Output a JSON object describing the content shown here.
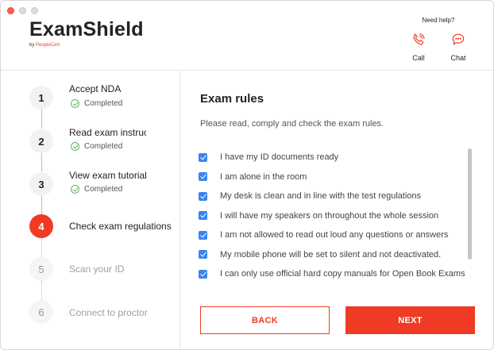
{
  "app": {
    "brand_name": "ExamShield",
    "brand_sub_prefix": "by ",
    "brand_sub_company": "PeopleCert"
  },
  "help": {
    "title": "Need help?",
    "call_label": "Call",
    "chat_label": "Chat",
    "call_icon": "phone-icon",
    "chat_icon": "chat-bubble-icon"
  },
  "steps": [
    {
      "number": "1",
      "title": "Accept NDA",
      "status": "Completed",
      "state": "done"
    },
    {
      "number": "2",
      "title": "Read exam instructions",
      "status": "Completed",
      "state": "done"
    },
    {
      "number": "3",
      "title": "View exam tutorial",
      "status": "Completed",
      "state": "done"
    },
    {
      "number": "4",
      "title": "Check exam regulations",
      "status": "",
      "state": "active"
    },
    {
      "number": "5",
      "title": "Scan your ID",
      "status": "",
      "state": "pending"
    },
    {
      "number": "6",
      "title": "Connect to proctor",
      "status": "",
      "state": "pending"
    }
  ],
  "main": {
    "title": "Exam rules",
    "description": "Please read, comply and check the exam rules.",
    "rules": [
      {
        "text": "I have my ID documents ready",
        "checked": true
      },
      {
        "text": "I am alone in the room",
        "checked": true
      },
      {
        "text": "My desk is clean and in line with the test regulations",
        "checked": true
      },
      {
        "text": "I will have my speakers on throughout the whole session",
        "checked": true
      },
      {
        "text": "I am not allowed to read out loud any questions or answers",
        "checked": true
      },
      {
        "text": "My mobile phone will be set to silent and not deactivated.",
        "checked": true
      },
      {
        "text": "I can only use official hard copy manuals for Open Book Exams",
        "checked": true
      }
    ],
    "back_label": "BACK",
    "next_label": "NEXT"
  },
  "colors": {
    "accent": "#ef3b24",
    "checkbox": "#3a84f0",
    "success": "#5cb85c"
  }
}
